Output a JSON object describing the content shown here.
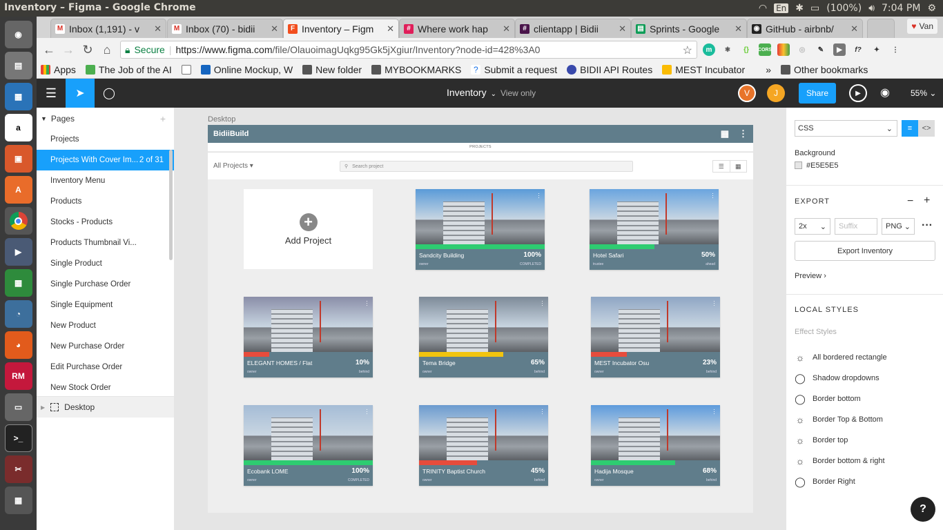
{
  "os": {
    "window_title": "Inventory – Figma - Google Chrome",
    "keyboard": "En",
    "battery": "(100%)",
    "clock": "7:04 PM"
  },
  "browser": {
    "tabs": [
      {
        "label": "Inbox (1,191) - v",
        "icon": "gmail-icon",
        "color": "#d93025"
      },
      {
        "label": "Inbox (70) - bidii",
        "icon": "gmail-icon",
        "color": "#d93025"
      },
      {
        "label": "Inventory – Figm",
        "icon": "figma-icon",
        "color": "#f24e1e"
      },
      {
        "label": "Where work hap",
        "icon": "slack-icon",
        "color": "#e01e5a"
      },
      {
        "label": "clientapp | Bidii",
        "icon": "slack-channel-icon",
        "color": "#4a154b"
      },
      {
        "label": "Sprints - Google",
        "icon": "sheets-icon",
        "color": "#0f9d58"
      },
      {
        "label": "GitHub - airbnb/",
        "icon": "github-icon",
        "color": "#222222"
      }
    ],
    "profile": "Van",
    "secure_label": "Secure",
    "url_host": "https://www.figma.com",
    "url_path": "/file/OlauoimagUqkg95Gk5jXgiur/Inventory?node-id=428%3A0",
    "bookmarks": [
      {
        "label": "Apps",
        "color": "#4285f4"
      },
      {
        "label": "The Job of the AI",
        "color": "#4caf50"
      },
      {
        "label": "",
        "color": "#777777"
      },
      {
        "label": "Online Mockup, W",
        "color": "#1565c0"
      },
      {
        "label": "New folder",
        "color": "#555555"
      },
      {
        "label": "MYBOOKMARKS",
        "color": "#555555"
      },
      {
        "label": "Submit a request",
        "color": "#1a73e8"
      },
      {
        "label": "BIDII API Routes",
        "color": "#3949ab"
      },
      {
        "label": "MEST Incubator",
        "color": "#fbbc04"
      }
    ],
    "bookmarks_more": "»",
    "other_bookmarks": "Other bookmarks"
  },
  "figma": {
    "file_name": "Inventory",
    "view_only": "View only",
    "avatars": [
      {
        "letter": "V",
        "color": "#e8742a"
      },
      {
        "letter": "J",
        "color": "#f5a623"
      }
    ],
    "share_label": "Share",
    "zoom": "55%",
    "pages_header": "Pages",
    "pages": [
      "Projects",
      "Projects With Cover Im...",
      "Inventory Menu",
      "Products",
      "Stocks - Products",
      "Products Thumbnail Vi...",
      "Single Product",
      "Single Purchase Order",
      "Single Equipment",
      "New Product",
      "New Purchase Order",
      "Edit Purchase Order",
      "New Stock Order"
    ],
    "selected_page_count": "2 of 31",
    "layer_name": "Desktop",
    "frame_label": "Desktop",
    "right_panel": {
      "code_lang": "CSS",
      "background_label": "Background",
      "background_value": "#E5E5E5",
      "export_header": "EXPORT",
      "export_scale": "2x",
      "export_suffix_placeholder": "Suffix",
      "export_format": "PNG",
      "export_button": "Export Inventory",
      "preview_label": "Preview",
      "local_styles_header": "LOCAL STYLES",
      "effect_styles_label": "Effect Styles",
      "styles": [
        {
          "label": "All bordered rectangle",
          "icon": "sun-icon"
        },
        {
          "label": "Shadow dropdowns",
          "icon": "circle-icon"
        },
        {
          "label": "Border bottom",
          "icon": "circle-icon"
        },
        {
          "label": "Border Top & Bottom",
          "icon": "sun-icon"
        },
        {
          "label": "Border top",
          "icon": "sun-icon"
        },
        {
          "label": "Border bottom & right",
          "icon": "sun-icon"
        },
        {
          "label": "Border Right",
          "icon": "circle-icon"
        }
      ],
      "help": "?"
    }
  },
  "design": {
    "brand": "BidiiBuild",
    "subtitle": "PROJECTS",
    "filter": "All Projects",
    "search_placeholder": "Search project",
    "add_project": "Add Project",
    "projects": [
      {
        "name": "Sandcity Building",
        "percent": "100%",
        "progress": 1.0,
        "left": "owner",
        "right": "COMPLETED",
        "color": "#2ecc71",
        "sky": "#5a9bd8"
      },
      {
        "name": "Hotel Safari",
        "percent": "50%",
        "progress": 0.5,
        "left": "trustee",
        "right": "ahead",
        "color": "#2ecc71",
        "sky": "#6aa5df"
      },
      {
        "name": "ELEGANT HOMES / Flat",
        "percent": "10%",
        "progress": 0.2,
        "left": "owner",
        "right": "behind",
        "color": "#e74c3c",
        "sky": "#8a8ea8"
      },
      {
        "name": "Tema Bridge",
        "percent": "65%",
        "progress": 0.65,
        "left": "owner",
        "right": "behind",
        "color": "#f1c40f",
        "sky": "#7d8a98"
      },
      {
        "name": "MEST Incubator Osu",
        "percent": "23%",
        "progress": 0.28,
        "left": "owner",
        "right": "behind",
        "color": "#e74c3c",
        "sky": "#8fa6c4"
      },
      {
        "name": "Ecobank LOME",
        "percent": "100%",
        "progress": 1.0,
        "left": "owner",
        "right": "COMPLETED",
        "color": "#2ecc71",
        "sky": "#a5bcd6"
      },
      {
        "name": "TRINITY Baptist Church",
        "percent": "45%",
        "progress": 0.45,
        "left": "owner",
        "right": "behind",
        "color": "#e74c3c",
        "sky": "#6b9bcf"
      },
      {
        "name": "Hadija Mosque",
        "percent": "68%",
        "progress": 0.65,
        "left": "owner",
        "right": "behind",
        "color": "#2ecc71",
        "sky": "#5d9bdc"
      }
    ]
  }
}
